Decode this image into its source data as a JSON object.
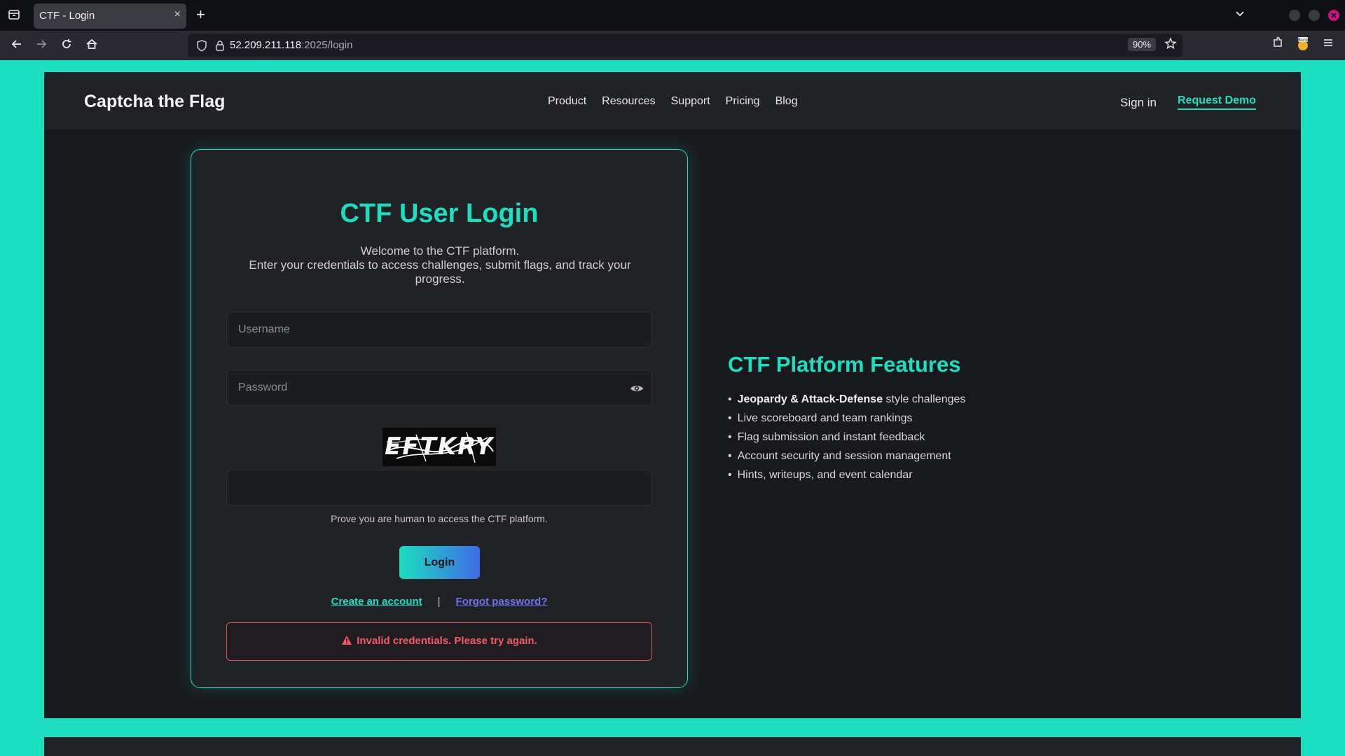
{
  "browser": {
    "tab_title": "CTF - Login",
    "tab_close": "×",
    "new_tab": "+",
    "url_host": "52.209.211.118",
    "url_rest": ":2025/login",
    "zoom": "90%",
    "extension_badge": "Burp"
  },
  "site": {
    "brand": "Captcha the Flag",
    "nav": [
      "Product",
      "Resources",
      "Support",
      "Pricing",
      "Blog"
    ],
    "sign_in": "Sign in",
    "request_demo": "Request Demo"
  },
  "login": {
    "title": "CTF User Login",
    "subtitle_line1": "Welcome to the CTF platform.",
    "subtitle_line2": "Enter your credentials to access challenges, submit flags, and track your progress.",
    "username_placeholder": "Username",
    "password_placeholder": "Password",
    "captcha_text": "EFTKRY",
    "captcha_value": "",
    "human_note": "Prove you are human to access the CTF platform.",
    "login_button": "Login",
    "create_account": "Create an account",
    "separator": "|",
    "forgot_password": "Forgot password?",
    "error": "Invalid credentials. Please try again."
  },
  "features": {
    "title": "CTF Platform Features",
    "items": [
      {
        "bold": "Jeopardy & Attack-Defense",
        "text": " style challenges"
      },
      {
        "bold": "",
        "text": "Live scoreboard and team rankings"
      },
      {
        "bold": "",
        "text": "Flag submission and instant feedback"
      },
      {
        "bold": "",
        "text": "Account security and session management"
      },
      {
        "bold": "",
        "text": "Hints, writeups, and event calendar"
      }
    ]
  },
  "colors": {
    "accent": "#1bdfc0",
    "error": "#ef5b67",
    "link_secondary": "#6b74e8",
    "page_bg": "#18191d"
  }
}
